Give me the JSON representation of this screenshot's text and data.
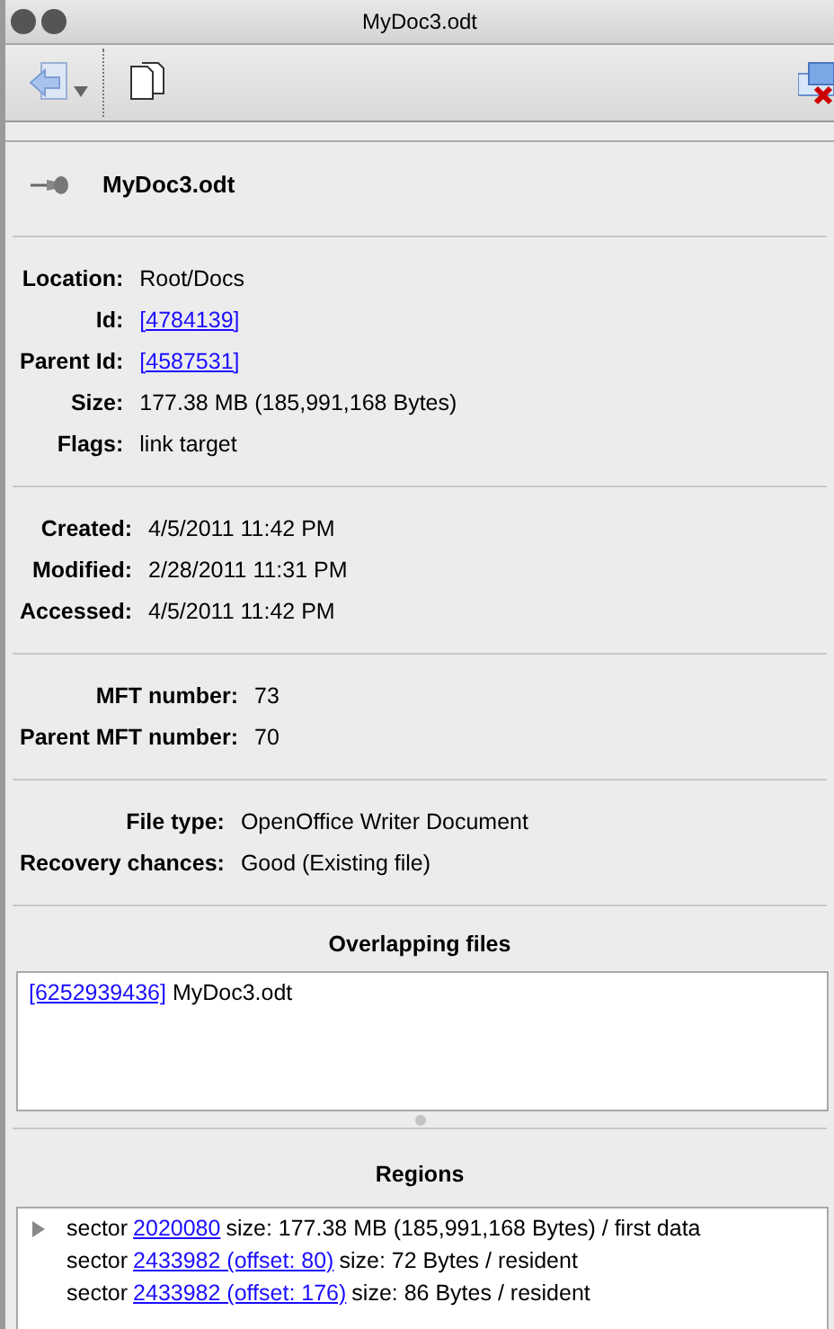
{
  "window": {
    "title": "MyDoc3.odt"
  },
  "header": {
    "title": "MyDoc3.odt"
  },
  "groups": [
    {
      "rows": [
        {
          "label": "Location:",
          "value": "Root/Docs",
          "kind": "text"
        },
        {
          "label": "Id:",
          "value": "[4784139]",
          "kind": "link"
        },
        {
          "label": "Parent Id:",
          "value": "[4587531]",
          "kind": "link"
        },
        {
          "label": "Size:",
          "value": "177.38 MB (185,991,168 Bytes)",
          "kind": "text"
        },
        {
          "label": "Flags:",
          "value": "link target",
          "kind": "text"
        }
      ]
    },
    {
      "rows": [
        {
          "label": "Created:",
          "value": "4/5/2011 11:42 PM",
          "kind": "text"
        },
        {
          "label": "Modified:",
          "value": "2/28/2011 11:31 PM",
          "kind": "text"
        },
        {
          "label": "Accessed:",
          "value": "4/5/2011 11:42 PM",
          "kind": "text"
        }
      ]
    },
    {
      "rows": [
        {
          "label": "MFT number:",
          "value": "73",
          "kind": "text"
        },
        {
          "label": "Parent MFT number:",
          "value": "70",
          "kind": "text"
        }
      ]
    },
    {
      "rows": [
        {
          "label": "File type:",
          "value": "OpenOffice Writer Document",
          "kind": "text"
        },
        {
          "label": "Recovery chances:",
          "value": "Good (Existing file)",
          "kind": "text"
        }
      ]
    }
  ],
  "overlapping_files": {
    "title": "Overlapping files",
    "items": [
      {
        "link": "[6252939436]",
        "name": "MyDoc3.odt"
      }
    ]
  },
  "regions": {
    "title": "Regions",
    "items": [
      {
        "kind": "parent",
        "expanded": false,
        "prefix": "sector",
        "link": "2020080",
        "rest": "size: 177.38 MB (185,991,168 Bytes) / first data"
      },
      {
        "kind": "leaf",
        "prefix": "sector",
        "link": "2433982 (offset: 80)",
        "rest": "size: 72 Bytes / resident"
      },
      {
        "kind": "leaf",
        "prefix": "sector",
        "link": "2433982 (offset: 176)",
        "rest": "size: 86 Bytes / resident"
      }
    ]
  }
}
